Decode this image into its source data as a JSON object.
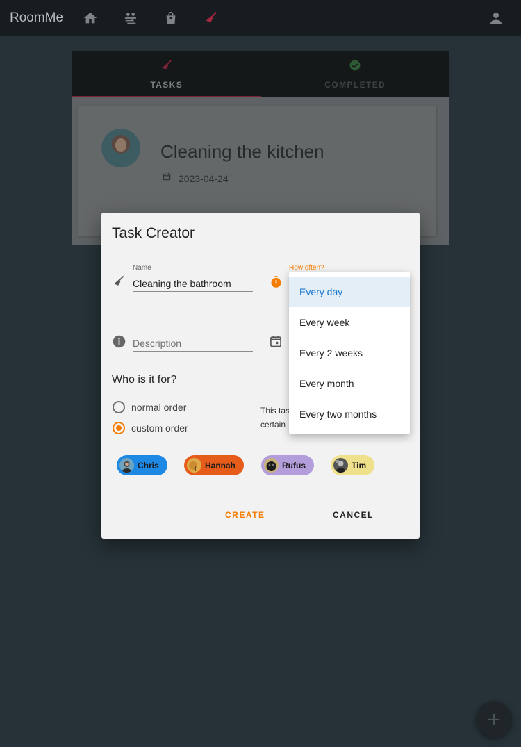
{
  "app": {
    "title": "RoomMe"
  },
  "nav": {
    "icons": [
      "home-icon",
      "roommates-icon",
      "shopping-bag-icon",
      "broom-icon",
      "profile-icon"
    ],
    "active_color": "#a3263f"
  },
  "tabs": [
    {
      "label": "TASKS",
      "icon": "broom-icon"
    },
    {
      "label": "COMPLETED",
      "icon": "check-circle-icon"
    }
  ],
  "task_card": {
    "title": "Cleaning the kitchen",
    "date": "2023-04-24"
  },
  "dialog": {
    "title": "Task Creator",
    "name_field": {
      "label": "Name",
      "value": "Cleaning the bathroom"
    },
    "frequency_field": {
      "label": "How often?"
    },
    "description_field": {
      "placeholder": "Description"
    },
    "assignee_section": {
      "title": "Who is it for?",
      "options": [
        {
          "label": "normal order",
          "checked": false
        },
        {
          "label": "custom order",
          "checked": true
        }
      ],
      "side_text_line1": "This tas",
      "side_text_line2": "certain"
    },
    "chips": [
      {
        "name": "Chris",
        "color": "#1e88e5"
      },
      {
        "name": "Hannah",
        "color": "#e65c1a"
      },
      {
        "name": "Rufus",
        "color": "#b39ddb"
      },
      {
        "name": "Tim",
        "color": "#efe08c"
      }
    ],
    "create_label": "CREATE",
    "cancel_label": "CANCEL",
    "accent_color": "#f57c00"
  },
  "frequency_menu": {
    "options": [
      "Every day",
      "Every week",
      "Every 2 weeks",
      "Every month",
      "Every two months"
    ],
    "selected": "Every day"
  },
  "fab": {
    "label": "+"
  }
}
